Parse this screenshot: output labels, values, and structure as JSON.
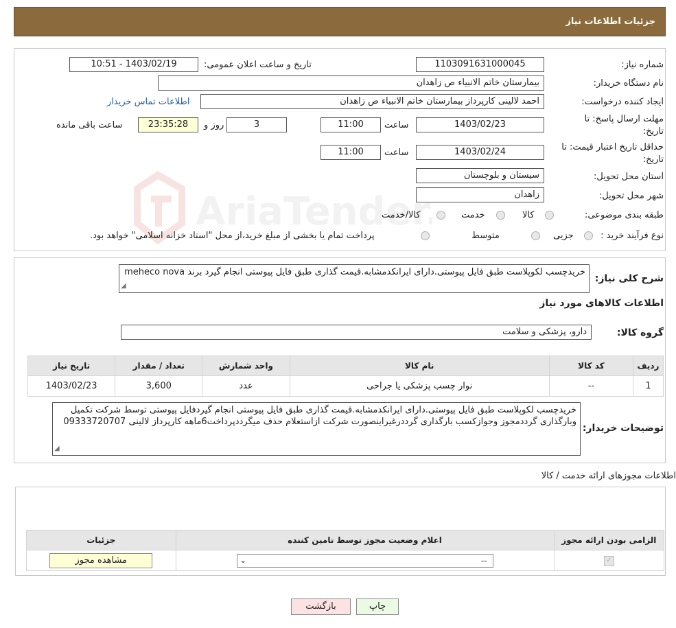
{
  "header": {
    "title": "جزئیات اطلاعات نیاز"
  },
  "form": {
    "need_number_label": "شماره نیاز:",
    "need_number": "1103091631000045",
    "announce_label": "تاریخ و ساعت اعلان عمومی:",
    "announce_value": "1403/02/19 - 10:51",
    "buyer_org_label": "نام دستگاه خریدار:",
    "buyer_org": "بیمارستان خاتم الانبیاء  ص  زاهدان",
    "creator_label": "ایجاد کننده درخواست:",
    "creator": "احمد لالینی کارپرداز بیمارستان خاتم الانبیاء  ص  زاهدان",
    "contact_link": "اطلاعات تماس خریدار",
    "deadline_label_1": "مهلت ارسال پاسخ: تا",
    "deadline_label_2": "تاریخ:",
    "deadline_date": "1403/02/23",
    "time_label": "ساعت",
    "deadline_time": "11:00",
    "days_value": "3",
    "days_label": "روز و",
    "remaining_time": "23:35:28",
    "remaining_label": "ساعت باقی مانده",
    "validity_label_1": "حداقل تاریخ اعتبار قیمت: تا",
    "validity_label_2": "تاریخ:",
    "validity_date": "1403/02/24",
    "validity_time": "11:00",
    "province_label": "استان محل تحویل:",
    "province": "سیستان و بلوچستان",
    "city_label": "شهر محل تحویل:",
    "city": "زاهدان",
    "category_label": "طبقه بندی موضوعی:",
    "category_options": [
      "کالا",
      "خدمت",
      "کالا/خدمت"
    ],
    "process_label": "نوع فرآیند خرید :",
    "process_options": [
      "جزیی",
      "متوسط"
    ],
    "process_note": "پرداخت تمام یا بخشی از مبلغ خرید،از محل \"اسناد خزانه اسلامی\" خواهد بود."
  },
  "details": {
    "summary_label": "شرح کلی نیاز:",
    "summary": "خریدچسب لکوپلاست طبق فایل پیوستی.دارای ایرانکدمشابه.قیمت گذاری طبق فایل پیوستی انجام گیرد برند meheco nova",
    "goods_info_title": "اطلاعات کالاهای مورد نیاز",
    "goods_group_label": "گروه کالا:",
    "goods_group": "دارو، پزشکی و سلامت",
    "table_headers": [
      "ردیف",
      "کد کالا",
      "نام کالا",
      "واحد شمارش",
      "تعداد / مقدار",
      "تاریخ نیاز"
    ],
    "table_rows": [
      [
        "1",
        "--",
        "نوار چسب پزشکی یا جراحی",
        "عدد",
        "3,600",
        "1403/02/23"
      ]
    ],
    "buyer_notes_label": "توضیحات خریدار:",
    "buyer_notes": "خریدچسب لکوپلاست طبق فایل پیوستی.دارای ایرانکدمشابه.قیمت گذاری طبق فایل پیوستی انجام گیردفایل پیوستی توسط شرکت تکمیل وبارگذاری گرددمجوز وجوازکسب بارگذاری گرددرغیراینصورت شرکت ازاستعلام حذف میگرددپرداخت6ماهه کارپرداز لالینی 09333720707"
  },
  "permits": {
    "title": "اطلاعات مجوزهای ارائه خدمت / کالا",
    "headers": [
      "الزامی بودن ارائه مجوز",
      "اعلام وضعیت مجوز توسط تامین کننده",
      "جزئیات"
    ],
    "select_value": "--",
    "view_button": "مشاهده مجوز"
  },
  "footer": {
    "print_button": "چاپ",
    "back_button": "بازگشت"
  },
  "watermark": {
    "text": "AriaTender.neT"
  }
}
